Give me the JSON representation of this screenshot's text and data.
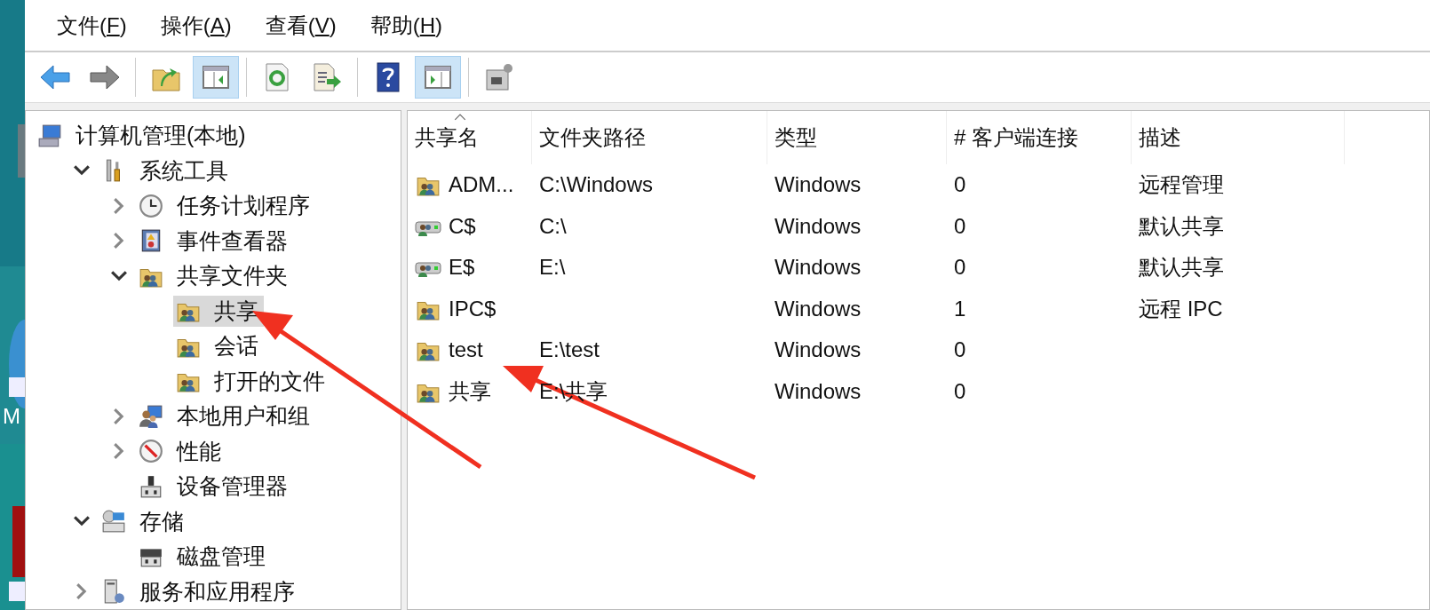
{
  "desktop": {
    "label": "M"
  },
  "menu": [
    {
      "label": "文件(",
      "key": "F",
      "end": ")"
    },
    {
      "label": "操作(",
      "key": "A",
      "end": ")"
    },
    {
      "label": "查看(",
      "key": "V",
      "end": ")"
    },
    {
      "label": "帮助(",
      "key": "H",
      "end": ")"
    }
  ],
  "toolbar": [
    {
      "kind": "back",
      "selected": false
    },
    {
      "kind": "forward",
      "selected": false
    },
    {
      "kind": "separator"
    },
    {
      "kind": "up",
      "selected": false
    },
    {
      "kind": "tree",
      "selected": true
    },
    {
      "kind": "separator"
    },
    {
      "kind": "refresh",
      "selected": false
    },
    {
      "kind": "export",
      "selected": false
    },
    {
      "kind": "separator"
    },
    {
      "kind": "help",
      "selected": false
    },
    {
      "kind": "action",
      "selected": true
    },
    {
      "kind": "separator"
    },
    {
      "kind": "properties",
      "selected": false
    }
  ],
  "tree": [
    {
      "label": "计算机管理(本地)",
      "kind": "computer",
      "selected": false,
      "children": [
        {
          "label": "系统工具",
          "kind": "tools",
          "selected": false,
          "expanded": true,
          "children": [
            {
              "label": "任务计划程序",
              "kind": "clock",
              "selected": false,
              "expanded": false
            },
            {
              "label": "事件查看器",
              "kind": "log",
              "selected": false,
              "expanded": false
            },
            {
              "label": "共享文件夹",
              "kind": "share",
              "selected": false,
              "expanded": true,
              "children": [
                {
                  "label": "共享",
                  "kind": "share",
                  "selected": true
                },
                {
                  "label": "会话",
                  "kind": "share",
                  "selected": false
                },
                {
                  "label": "打开的文件",
                  "kind": "share",
                  "selected": false
                }
              ]
            },
            {
              "label": "本地用户和组",
              "kind": "users",
              "selected": false,
              "expanded": false
            },
            {
              "label": "性能",
              "kind": "gauge",
              "selected": false,
              "expanded": false
            },
            {
              "label": "设备管理器",
              "kind": "device",
              "selected": false
            }
          ]
        },
        {
          "label": "存储",
          "kind": "storage",
          "selected": false,
          "expanded": true,
          "children": [
            {
              "label": "磁盘管理",
              "kind": "disk",
              "selected": false
            }
          ]
        },
        {
          "label": "服务和应用程序",
          "kind": "services",
          "selected": false,
          "expanded": false
        }
      ]
    }
  ],
  "table": {
    "columns": [
      {
        "label": "共享名",
        "sorted": true
      },
      {
        "label": "文件夹路径",
        "sorted": false
      },
      {
        "label": "类型",
        "sorted": false
      },
      {
        "label": "# 客户端连接",
        "sorted": false
      },
      {
        "label": "描述",
        "sorted": false
      }
    ],
    "rows": [
      {
        "kind": "folder",
        "cells": [
          "ADM...",
          "C:\\Windows",
          "Windows",
          "0",
          "远程管理"
        ]
      },
      {
        "kind": "drive",
        "cells": [
          "C$",
          "C:\\",
          "Windows",
          "0",
          "默认共享"
        ]
      },
      {
        "kind": "drive",
        "cells": [
          "E$",
          "E:\\",
          "Windows",
          "0",
          "默认共享"
        ]
      },
      {
        "kind": "folder",
        "cells": [
          "IPC$",
          "",
          "Windows",
          "1",
          "远程 IPC"
        ]
      },
      {
        "kind": "folder",
        "cells": [
          "test",
          "E:\\test",
          "Windows",
          "0",
          ""
        ]
      },
      {
        "kind": "folder",
        "cells": [
          "共享",
          "E:\\共享",
          "Windows",
          "0",
          ""
        ]
      }
    ]
  }
}
